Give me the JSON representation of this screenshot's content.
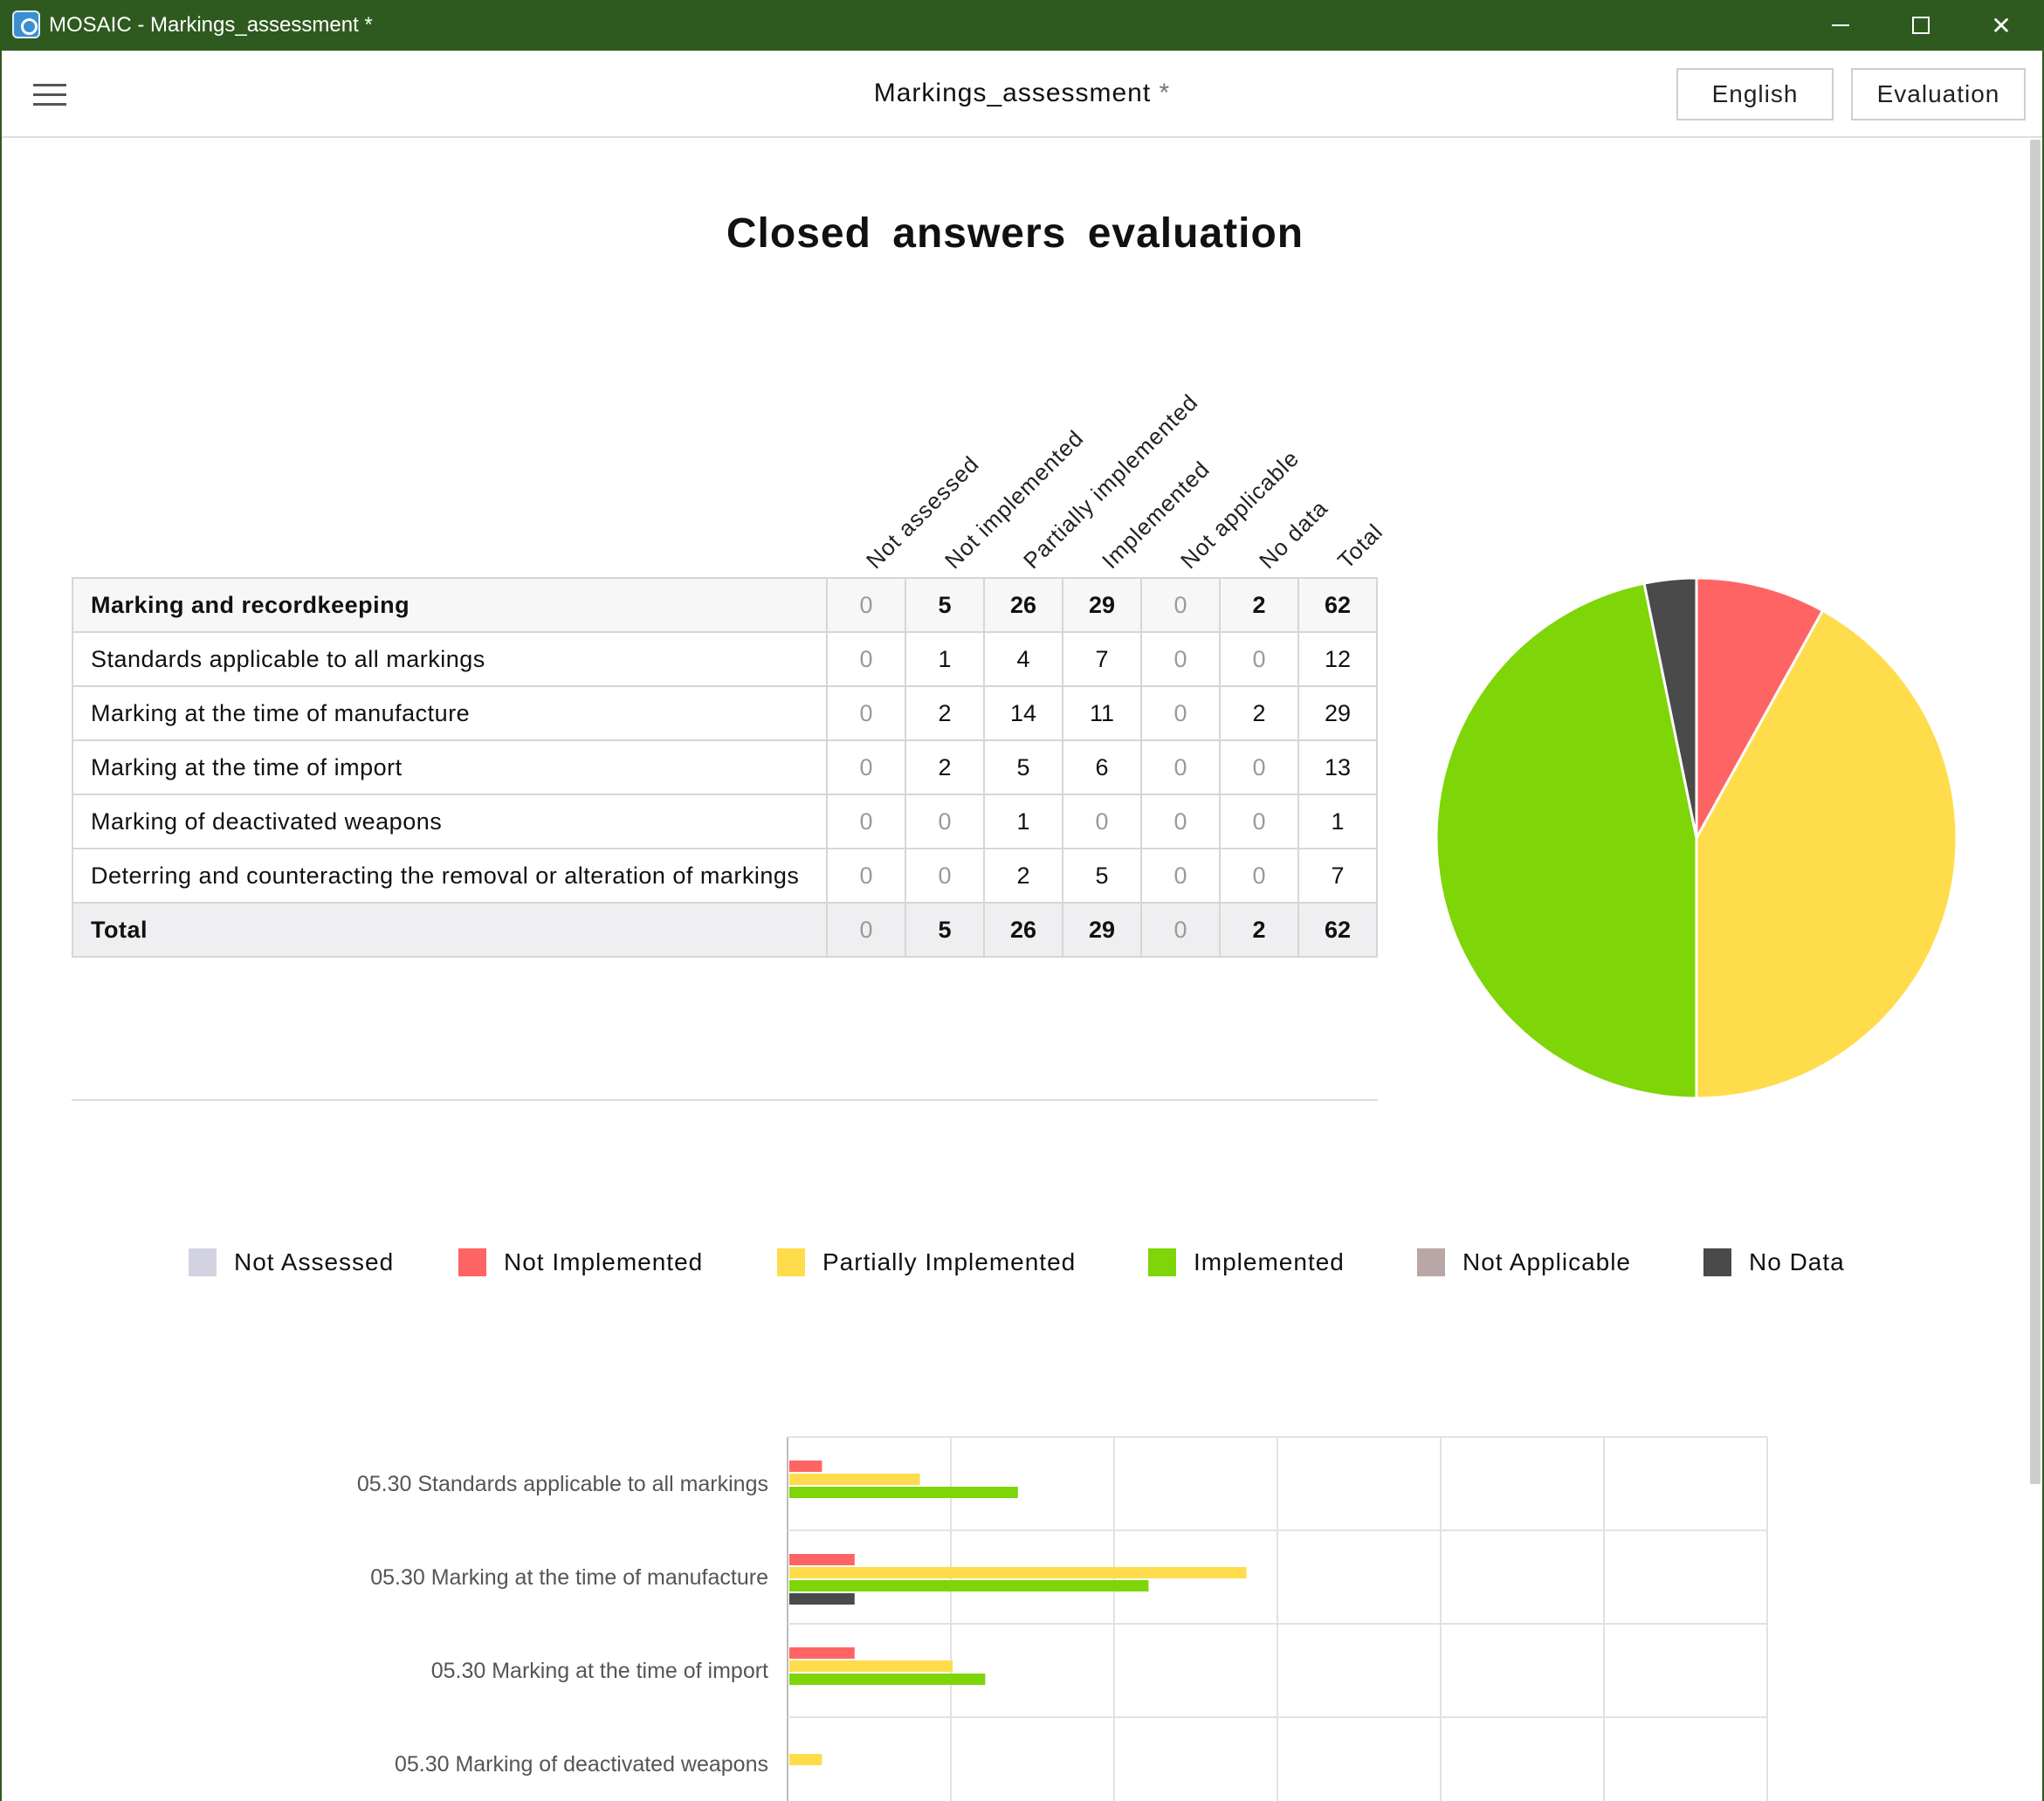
{
  "window": {
    "title": "MOSAIC - Markings_assessment *"
  },
  "header": {
    "doc_title": "Markings_assessment",
    "unsaved_mark": "*",
    "language_button": "English",
    "evaluation_button": "Evaluation"
  },
  "main": {
    "title": "Closed  answers  evaluation"
  },
  "table": {
    "columns": [
      "Not assessed",
      "Not implemented",
      "Partially implemented",
      "Implemented",
      "Not applicable",
      "No data",
      "Total"
    ],
    "rows": [
      {
        "label": "Marking and recordkeeping",
        "values": [
          "0",
          "5",
          "26",
          "29",
          "0",
          "2",
          "62"
        ]
      },
      {
        "label": "Standards applicable to all markings",
        "values": [
          "0",
          "1",
          "4",
          "7",
          "0",
          "0",
          "12"
        ]
      },
      {
        "label": "Marking at the time of manufacture",
        "values": [
          "0",
          "2",
          "14",
          "11",
          "0",
          "2",
          "29"
        ]
      },
      {
        "label": "Marking at the time of import",
        "values": [
          "0",
          "2",
          "5",
          "6",
          "0",
          "0",
          "13"
        ]
      },
      {
        "label": "Marking of deactivated weapons",
        "values": [
          "0",
          "0",
          "1",
          "0",
          "0",
          "0",
          "1"
        ]
      },
      {
        "label": "Deterring and counteracting the removal or alteration of markings",
        "values": [
          "0",
          "0",
          "2",
          "5",
          "0",
          "0",
          "7"
        ]
      },
      {
        "label": "Total",
        "values": [
          "0",
          "5",
          "26",
          "29",
          "0",
          "2",
          "62"
        ]
      }
    ]
  },
  "legend": [
    {
      "label": "Not Assessed",
      "color": "#d3d2e0"
    },
    {
      "label": "Not Implemented",
      "color": "#ff6464"
    },
    {
      "label": "Partially Implemented",
      "color": "#ffdc4b"
    },
    {
      "label": "Implemented",
      "color": "#7ed507"
    },
    {
      "label": "Not Applicable",
      "color": "#b9a7a7"
    },
    {
      "label": "No Data",
      "color": "#4a4a4a"
    }
  ],
  "chart_data": [
    {
      "type": "pie",
      "labels": [
        "Not Implemented",
        "Partially Implemented",
        "Implemented",
        "No Data"
      ],
      "values": [
        5,
        26,
        29,
        2
      ],
      "colors": [
        "#ff6464",
        "#ffdc4b",
        "#7ed507",
        "#4a4a4a"
      ]
    },
    {
      "type": "bar",
      "orientation": "horizontal",
      "categories": [
        "05.30 Standards applicable to all markings",
        "05.30 Marking at the time of manufacture",
        "05.30 Marking at the time of import",
        "05.30 Marking of deactivated weapons"
      ],
      "series": [
        {
          "name": "Not Implemented",
          "color": "#ff6464",
          "values": [
            1,
            2,
            2,
            0
          ]
        },
        {
          "name": "Partially Implemented",
          "color": "#ffdc4b",
          "values": [
            4,
            14,
            5,
            1
          ]
        },
        {
          "name": "Implemented",
          "color": "#7ed507",
          "values": [
            7,
            11,
            6,
            0
          ]
        },
        {
          "name": "No Data",
          "color": "#4a4a4a",
          "values": [
            0,
            2,
            0,
            0
          ]
        }
      ],
      "xlim": [
        0,
        30
      ],
      "grid": true
    }
  ]
}
